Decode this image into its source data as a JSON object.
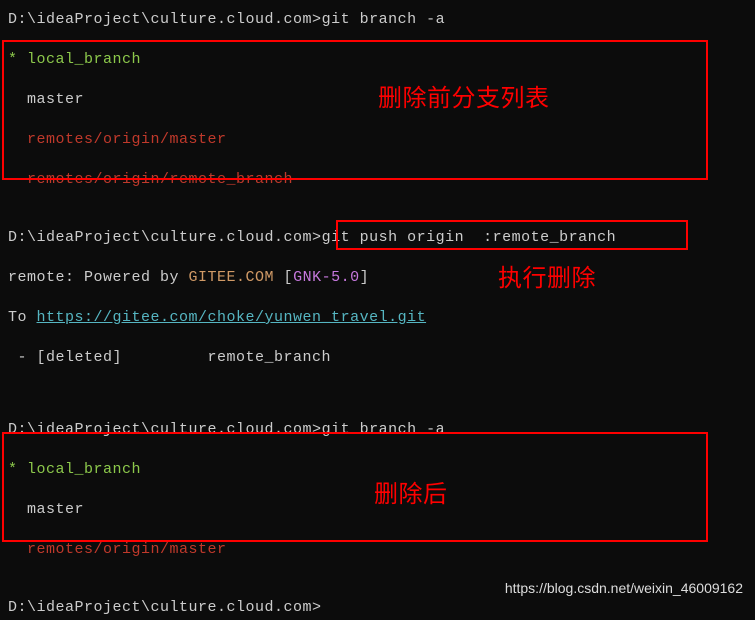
{
  "section1": {
    "prompt": "D:\\ideaProject\\culture.cloud.com>",
    "cmd": "git branch -a",
    "branches": {
      "current": "* local_branch",
      "master": "  master",
      "remote1": "  remotes/origin/master",
      "remote2": "  remotes/origin/remote_branch"
    },
    "annotation": "删除前分支列表"
  },
  "section2": {
    "prompt": "D:\\ideaProject\\culture.cloud.com>",
    "cmd": "git push origin  :remote_branch",
    "line1_pre": "remote: Powered by ",
    "line1_gitee": "GITEE.COM",
    "line1_bracket_open": " [",
    "line1_gnk": "GNK-5.0",
    "line1_bracket_close": "]",
    "line2_pre": "To ",
    "line2_link": "https://gitee.com/choke/yunwen_travel.git",
    "line3": " - [deleted]         remote_branch",
    "annotation": "执行删除"
  },
  "section3": {
    "prompt": "D:\\ideaProject\\culture.cloud.com>",
    "cmd": "git branch -a",
    "branches": {
      "current": "* local_branch",
      "master": "  master",
      "remote1": "  remotes/origin/master"
    },
    "annotation": "删除后"
  },
  "section4": {
    "prompt": "D:\\ideaProject\\culture.cloud.com>"
  },
  "watermark": "https://blog.csdn.net/weixin_46009162"
}
